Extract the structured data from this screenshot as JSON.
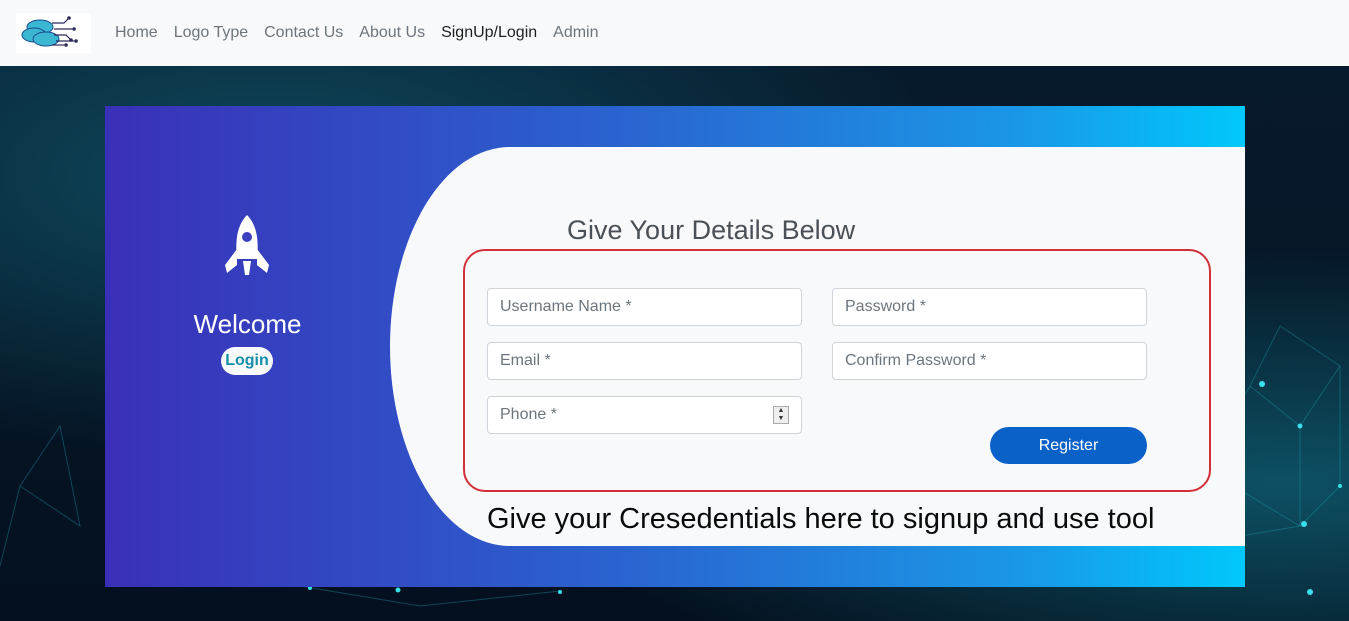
{
  "nav": {
    "logo_alt": "logo",
    "links": [
      "Home",
      "Logo Type",
      "Contact Us",
      "About Us",
      "SignUp/Login",
      "Admin"
    ],
    "active_index": 4
  },
  "left_panel": {
    "icon": "rocket-icon",
    "welcome": "Welcome",
    "login_label": "Login"
  },
  "form": {
    "title": "Give Your Details Below",
    "username_placeholder": "Username Name *",
    "password_placeholder": "Password *",
    "email_placeholder": "Email *",
    "confirm_password_placeholder": "Confirm Password *",
    "phone_placeholder": "Phone *",
    "register_label": "Register"
  },
  "annotation": {
    "caption": "Give your Cresedentials here to signup and use tool",
    "highlight_color": "#d32f3a"
  },
  "colors": {
    "gradient_start": "#3a30b8",
    "gradient_end": "#00c8fb",
    "register_button": "#0a62c9",
    "login_text": "#138fa8"
  }
}
